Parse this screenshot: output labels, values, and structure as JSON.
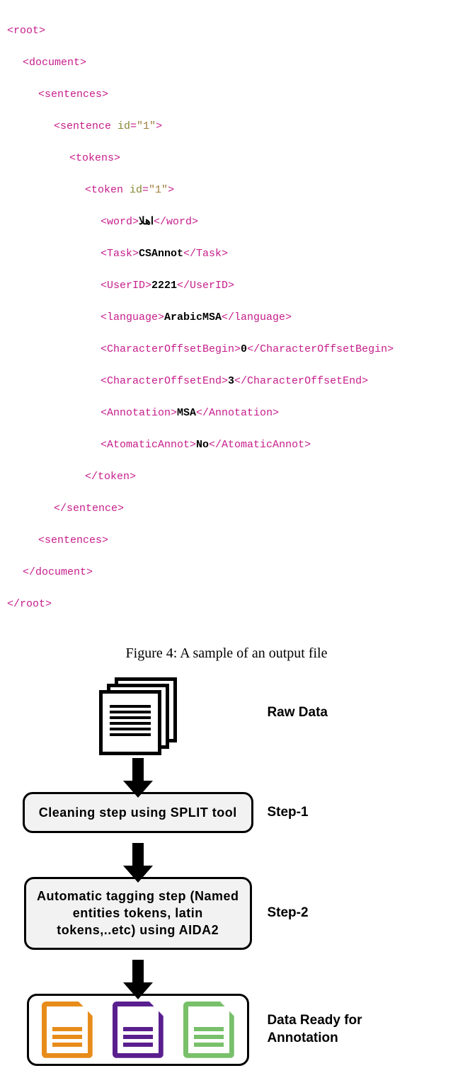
{
  "xml": {
    "root_open": "<root>",
    "document_open": "<document>",
    "sentences_open": "<sentences>",
    "sentence_open_pre": "<sentence ",
    "sentence_attr": "id",
    "sentence_val": "\"1\"",
    "close_gt": ">",
    "tokens_open": "<tokens>",
    "token_open_pre": "<token ",
    "token_attr": "id",
    "token_val": "\"1\"",
    "word_open": "<word>",
    "word_text": "اهلا",
    "word_close": "</word>",
    "task_open": "<Task>",
    "task_text": "CSAnnot",
    "task_close": "</Task>",
    "userid_open": "<UserID>",
    "userid_text": "2221",
    "userid_close": "</UserID>",
    "lang_open": "<language>",
    "lang_text": "ArabicMSA",
    "lang_close": "</language>",
    "cob_open": "<CharacterOffsetBegin>",
    "cob_text": "0",
    "cob_close": "</CharacterOffsetBegin>",
    "coe_open": "<CharacterOffsetEnd>",
    "coe_text": "3",
    "coe_close": "</CharacterOffsetEnd>",
    "annot_open": "<Annotation>",
    "annot_text": "MSA",
    "annot_close": "</Annotation>",
    "atom_open": "<AtomaticAnnot>",
    "atom_text": "No",
    "atom_close": "</AtomaticAnnot>",
    "token_close": "</token>",
    "sentence_close": "</sentence>",
    "sentences_close": "<sentences>",
    "document_close": "</document>",
    "root_close": "</root>"
  },
  "caption": "Figure 4: A sample of an output file",
  "diagram": {
    "raw_label": "Raw Data",
    "step1_box": "Cleaning step using SPLIT tool",
    "step1_label": "Step-1",
    "step2_box": "Automatic tagging step (Named entities tokens, latin tokens,..etc) using AIDA2",
    "step2_label": "Step-2",
    "ready_label": "Data Ready for Annotation"
  }
}
